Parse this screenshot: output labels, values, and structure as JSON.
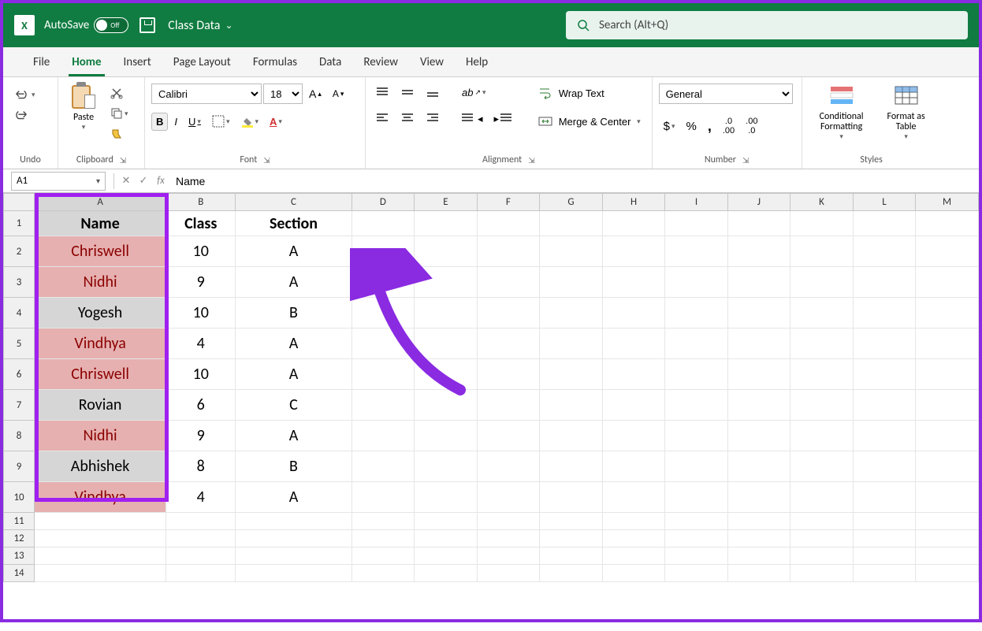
{
  "titlebar": {
    "autosave_label": "AutoSave",
    "autosave_state": "Off",
    "filename": "Class Data"
  },
  "search": {
    "placeholder": "Search (Alt+Q)"
  },
  "tabs": [
    "File",
    "Home",
    "Insert",
    "Page Layout",
    "Formulas",
    "Data",
    "Review",
    "View",
    "Help"
  ],
  "active_tab": "Home",
  "ribbon": {
    "undo": {
      "label": "Undo"
    },
    "clipboard": {
      "paste": "Paste",
      "label": "Clipboard"
    },
    "font": {
      "name": "Calibri",
      "size": "18",
      "bold": "B",
      "italic": "I",
      "underline": "U",
      "label": "Font"
    },
    "alignment": {
      "wrap": "Wrap Text",
      "merge": "Merge & Center",
      "label": "Alignment"
    },
    "number": {
      "format": "General",
      "label": "Number"
    },
    "styles": {
      "conditional": "Conditional Formatting",
      "formatastable": "Format as Table",
      "label": "Styles"
    }
  },
  "namebox": "A1",
  "formula": "Name",
  "columns": [
    "A",
    "B",
    "C",
    "D",
    "E",
    "F",
    "G",
    "H",
    "I",
    "J",
    "K",
    "L",
    "M"
  ],
  "col_widths": {
    "A": 170,
    "B": 90,
    "C": 150,
    "other": 82
  },
  "data": {
    "headers": [
      "Name",
      "Class",
      "Section"
    ],
    "rows": [
      {
        "name": "Chriswell",
        "class": "10",
        "section": "A",
        "dup": true
      },
      {
        "name": "Nidhi",
        "class": "9",
        "section": "A",
        "dup": true
      },
      {
        "name": "Yogesh",
        "class": "10",
        "section": "B",
        "dup": false
      },
      {
        "name": "Vindhya",
        "class": "4",
        "section": "A",
        "dup": true
      },
      {
        "name": "Chriswell",
        "class": "10",
        "section": "A",
        "dup": true
      },
      {
        "name": "Rovian",
        "class": "6",
        "section": "C",
        "dup": false
      },
      {
        "name": "Nidhi",
        "class": "9",
        "section": "A",
        "dup": true
      },
      {
        "name": "Abhishek",
        "class": "8",
        "section": "B",
        "dup": false
      },
      {
        "name": "Vindhya",
        "class": "4",
        "section": "A",
        "dup": true
      }
    ],
    "empty_rows": [
      11,
      12,
      13,
      14
    ]
  },
  "chart_data": {
    "type": "table",
    "title": "Class Data",
    "columns": [
      "Name",
      "Class",
      "Section"
    ],
    "rows": [
      [
        "Chriswell",
        10,
        "A"
      ],
      [
        "Nidhi",
        9,
        "A"
      ],
      [
        "Yogesh",
        10,
        "B"
      ],
      [
        "Vindhya",
        4,
        "A"
      ],
      [
        "Chriswell",
        10,
        "A"
      ],
      [
        "Rovian",
        6,
        "C"
      ],
      [
        "Nidhi",
        9,
        "A"
      ],
      [
        "Abhishek",
        8,
        "B"
      ],
      [
        "Vindhya",
        4,
        "A"
      ]
    ]
  }
}
